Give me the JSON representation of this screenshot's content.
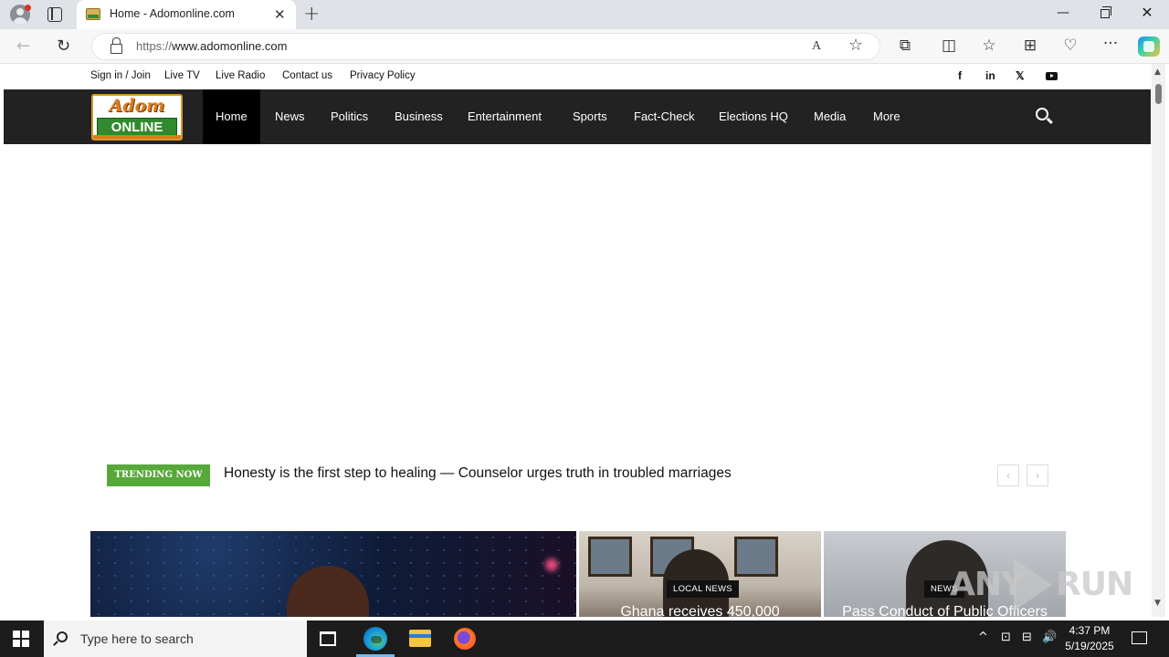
{
  "browser": {
    "tab_title": "Home - Adomonline.com",
    "new_tab_label": "+",
    "tab_close_label": "✕",
    "url_protocol": "https://",
    "url_host": "www.adomonline.com",
    "back_label": "←",
    "reload_label": "↻",
    "read_aloud_label": "A",
    "favorite_label": "☆",
    "extensions_label": "⧉",
    "split_label": "◫",
    "favorites_label": "☆",
    "collections_label": "⊞",
    "performance_label": "♡",
    "menu_label": "···",
    "minimize_label": "—",
    "close_label": "✕"
  },
  "site": {
    "top_links": [
      "Sign in / Join",
      "Live TV",
      "Live Radio",
      "Contact us",
      "Privacy Policy"
    ],
    "social": [
      "f",
      "in",
      "𝕏"
    ],
    "logo_top": "Adom",
    "logo_bottom": "ONLINE",
    "nav": [
      "Home",
      "News",
      "Politics",
      "Business",
      "Entertainment",
      "Sports",
      "Fact-Check",
      "Elections HQ",
      "Media",
      "More"
    ],
    "active_nav": "Home",
    "trending_label": "TRENDING NOW",
    "trending_headline": "Honesty is the first step to healing — Counselor urges truth in troubled marriages",
    "trend_prev": "‹",
    "trend_next": "›",
    "featured": [
      {
        "badge": "LOCAL NEWS",
        "title": "Ghana receives 450,000"
      },
      {
        "badge": "NEWS",
        "title": "Pass Conduct of Public Officers"
      }
    ]
  },
  "watermark": {
    "left": "ANY",
    "right": "RUN"
  },
  "scrollbar": {
    "up": "▲",
    "down": "▼"
  },
  "taskbar": {
    "search_placeholder": "Type here to search",
    "time": "4:37 PM",
    "date": "5/19/2025",
    "tray_chevron": "^",
    "tray_meet": "⊡",
    "tray_network": "⊟",
    "tray_volume": "🔊"
  },
  "colors": {
    "nav_bg": "#222222",
    "trending_green": "#57a83a",
    "logo_green": "#2e8b2e",
    "logo_orange": "#e07a1b"
  }
}
